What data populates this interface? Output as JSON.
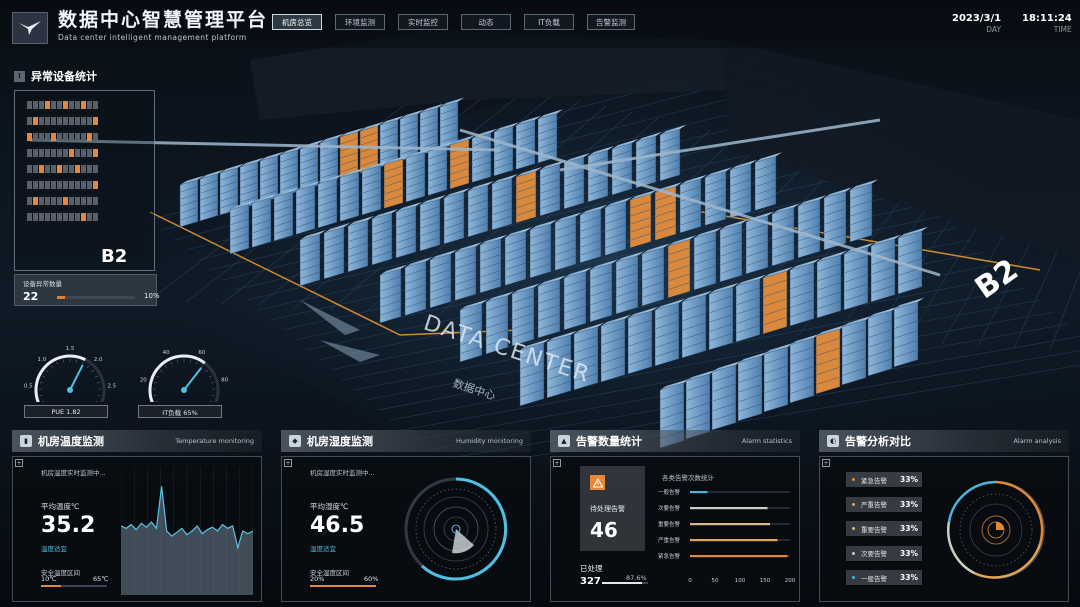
{
  "header": {
    "title": "数据中心智慧管理平台",
    "subtitle": "Data center intelligent management platform",
    "tabs": [
      {
        "label": "机房总览",
        "active": true
      },
      {
        "label": "环境监测",
        "active": false
      },
      {
        "label": "实时监控",
        "active": false
      },
      {
        "label": "动态",
        "active": false
      },
      {
        "label": "IT负载",
        "active": false
      },
      {
        "label": "告警监测",
        "active": false
      }
    ],
    "date": "2023/3/1",
    "date_label": "DAY",
    "time": "18:11:24",
    "time_label": "TIME"
  },
  "scene": {
    "floor_label": "B2",
    "dc_title": "DATA CENTER",
    "dc_subtitle": "数据中心"
  },
  "abnormal": {
    "title": "异常设备统计",
    "floor": "B2",
    "count_label": "设备异常数量",
    "count": "22",
    "percent_text": "10%",
    "percent_value": 10
  },
  "gauges": [
    {
      "label": "PUE 1.82",
      "ticks": [
        "0",
        "0.5",
        "1.0",
        "1.5",
        "2.0",
        "2.5",
        "3.0"
      ],
      "value": 1.82,
      "min": 0,
      "max": 3
    },
    {
      "label": "IT负载 65%",
      "ticks": [
        "0",
        "20",
        "40",
        "60",
        "80",
        "100"
      ],
      "value": 65,
      "min": 0,
      "max": 100
    }
  ],
  "temperature": {
    "title": "机房温度监测",
    "subtitle": "Temperature monitoring",
    "chart_title": "机房温度实时监测中...",
    "avg_label": "平均温度℃",
    "avg_value": "35.2",
    "status": "温度适宜",
    "range_label": "安全温度区间",
    "range_min": "10℃",
    "range_max": "65℃",
    "series": [
      54,
      52,
      55,
      51,
      56,
      53,
      57,
      52,
      85,
      50,
      46,
      49,
      52,
      47,
      50,
      54,
      48,
      51,
      53,
      50,
      55,
      52,
      54,
      37,
      50,
      48,
      50
    ]
  },
  "humidity": {
    "title": "机房湿度监测",
    "subtitle": "Humidity monitoring",
    "chart_title": "机房湿度实时监测中...",
    "avg_label": "平均湿度℃",
    "avg_value": "46.5",
    "status": "湿度适宜",
    "range_label": "安全湿度区间",
    "range_min": "20%",
    "range_max": "60%"
  },
  "alarm": {
    "title": "告警数量统计",
    "subtitle": "Alarm statistics",
    "pending_label": "待处理告警",
    "pending": "46",
    "processed_label": "已处理",
    "processed": "327",
    "processed_pct": "87.6%",
    "processed_value": 87.6,
    "chart_title": "各类告警次数统计",
    "chart_data": {
      "type": "bar",
      "orientation": "horizontal",
      "categories": [
        "一般告警",
        "次要告警",
        "重要告警",
        "严重告警",
        "紧急告警"
      ],
      "values": [
        35,
        155,
        160,
        175,
        195
      ],
      "colors": [
        "#4fb3d9",
        "#c7d2bf",
        "#d9b98c",
        "#e2a35a",
        "#e58838"
      ],
      "xlim": [
        0,
        200
      ],
      "xticks": [
        "0",
        "50",
        "100",
        "150",
        "200"
      ]
    }
  },
  "analysis": {
    "title": "告警分析对比",
    "subtitle": "Alarm analysis",
    "items": [
      {
        "name": "紧急告警",
        "value": "33%",
        "color": "#e58838"
      },
      {
        "name": "严重告警",
        "value": "33%",
        "color": "#e2a35a"
      },
      {
        "name": "重要告警",
        "value": "33%",
        "color": "#d9b98c"
      },
      {
        "name": "次要告警",
        "value": "33%",
        "color": "#c7d2bf"
      },
      {
        "name": "一般告警",
        "value": "33%",
        "color": "#4fb3d9"
      }
    ]
  }
}
